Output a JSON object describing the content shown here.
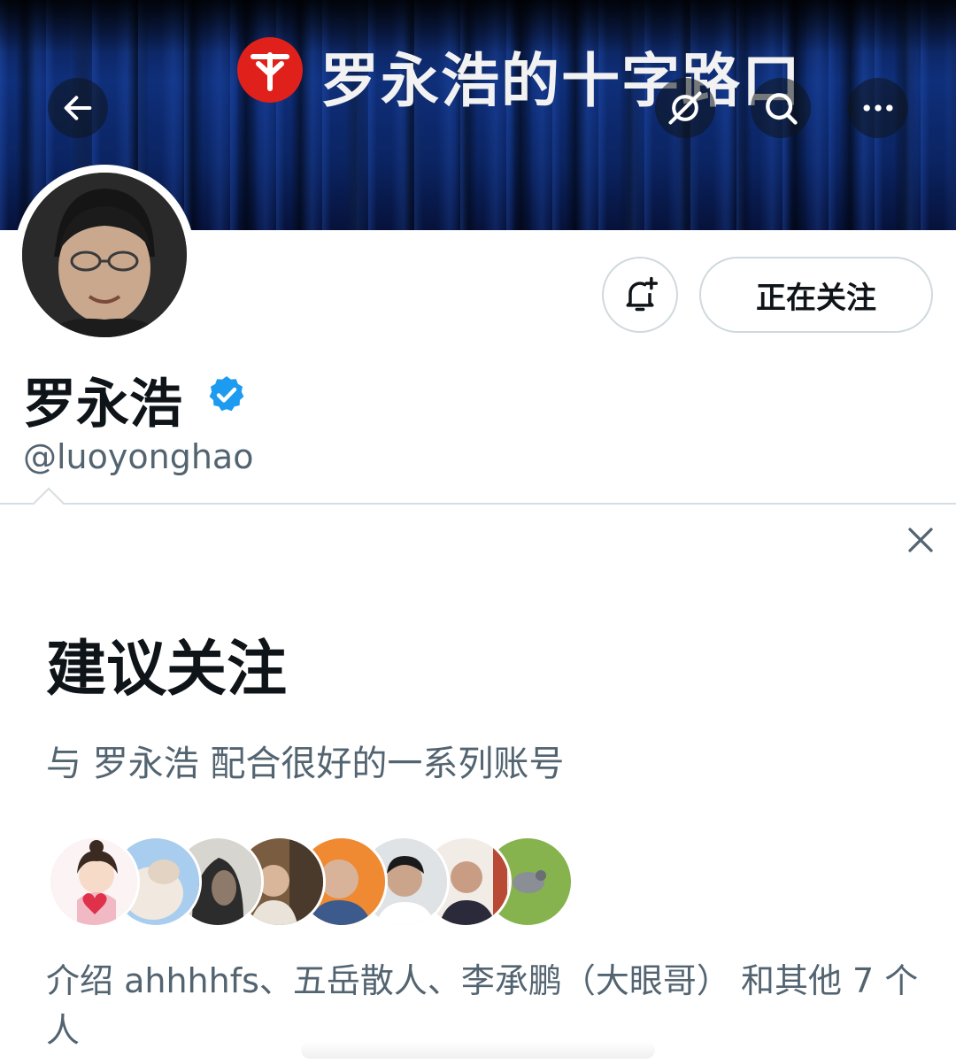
{
  "banner": {
    "title": "罗永浩的十字路口",
    "logo_icon": "red-circle-logo-icon",
    "colors": {
      "logo": "#e0201b",
      "curtain": "#0f2f7a"
    }
  },
  "nav": {
    "back_icon": "back-arrow-icon",
    "grok_icon": "grok-icon",
    "search_icon": "search-icon",
    "more_icon": "more-horizontal-icon"
  },
  "profile": {
    "display_name": "罗永浩",
    "handle": "@luoyonghao",
    "verified_color": "#1d9bf0",
    "following_label": "正在关注",
    "notify_icon": "bell-plus-icon"
  },
  "suggestions": {
    "title": "建议关注",
    "subtitle": "与 罗永浩 配合很好的一系列账号",
    "close_icon": "close-icon",
    "footer": "介绍 ahhhhfs、五岳散人、李承鹏（大眼哥） 和其他 7 个人",
    "avatars": [
      {
        "name": "suggested-avatar-1",
        "color": "#f4d2d8"
      },
      {
        "name": "suggested-avatar-2",
        "color": "#9cc4e8"
      },
      {
        "name": "suggested-avatar-3",
        "color": "#3c3c3c"
      },
      {
        "name": "suggested-avatar-4",
        "color": "#8a6a4c"
      },
      {
        "name": "suggested-avatar-5",
        "color": "#e8883a"
      },
      {
        "name": "suggested-avatar-6",
        "color": "#cfd6dc"
      },
      {
        "name": "suggested-avatar-7",
        "color": "#a64a3a"
      },
      {
        "name": "suggested-avatar-8",
        "color": "#7faa4c"
      }
    ]
  }
}
